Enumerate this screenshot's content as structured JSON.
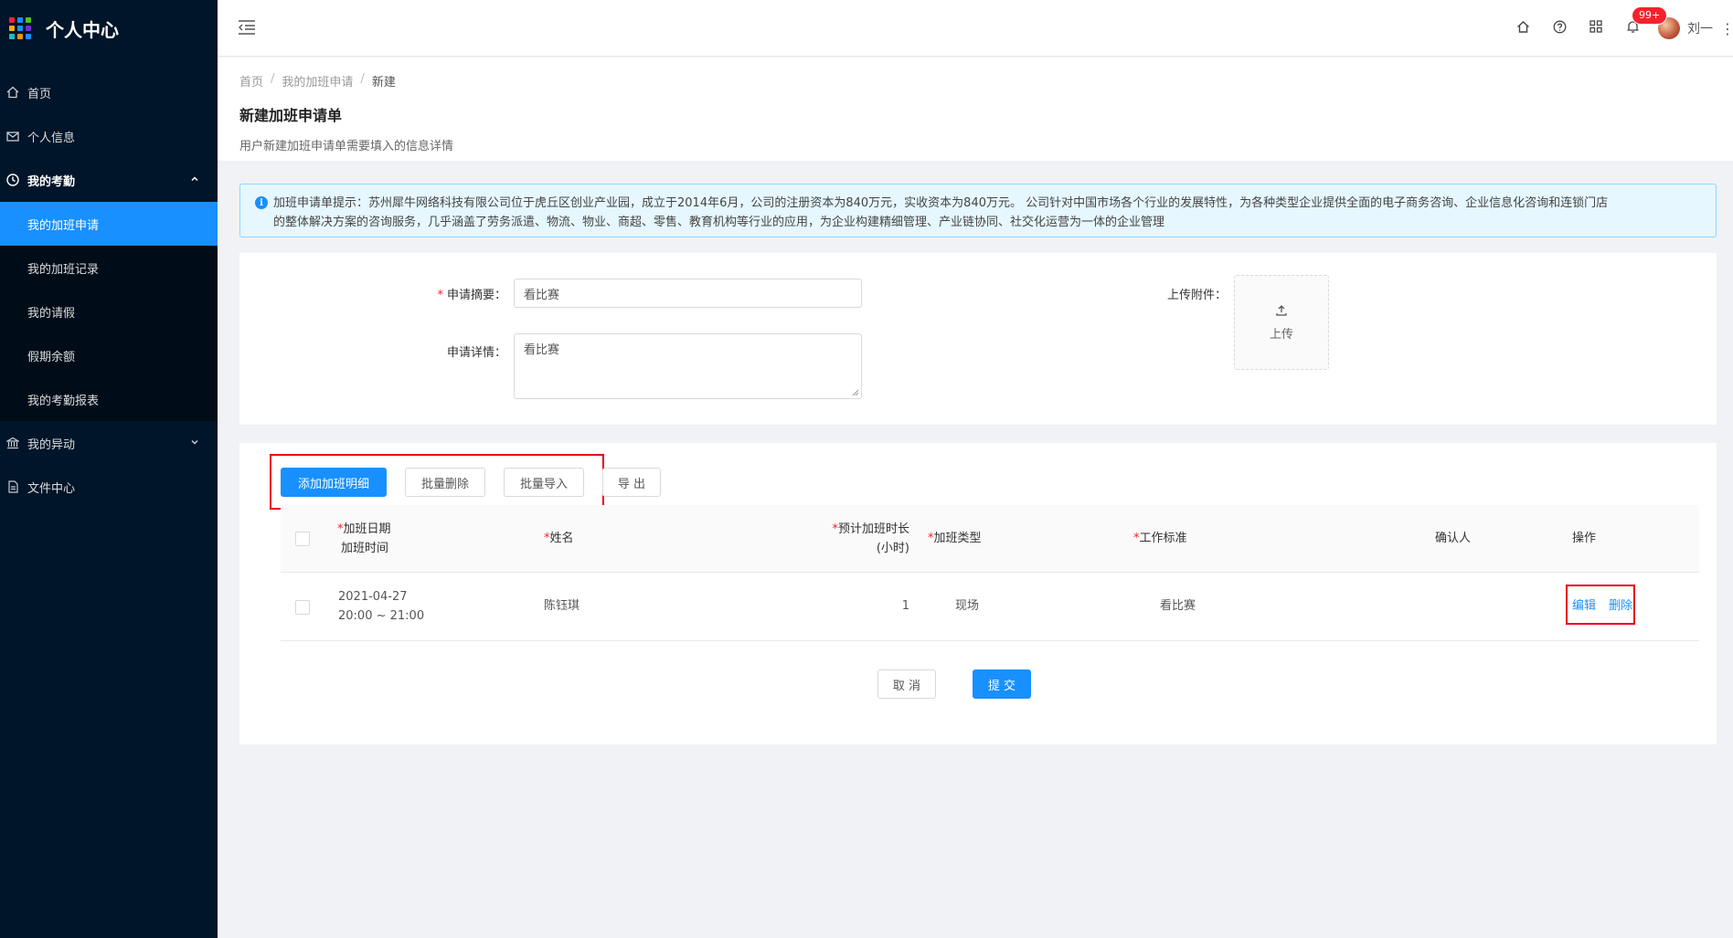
{
  "app": {
    "title": "个人中心",
    "logo_colors": [
      "#f5222d",
      "#1890ff",
      "#52c41a",
      "#faad14",
      "#1890ff",
      "#722ed1",
      "#13c2c2",
      "#fa8c16",
      "#1890ff"
    ]
  },
  "sidebar": {
    "items": [
      {
        "label": "首页",
        "icon": "home-icon"
      },
      {
        "label": "个人信息",
        "icon": "mail-icon"
      },
      {
        "label": "我的考勤",
        "icon": "clock-icon",
        "open": true
      },
      {
        "label": "我的异动",
        "icon": "bank-icon"
      },
      {
        "label": "文件中心",
        "icon": "file-icon"
      }
    ],
    "submenu": [
      {
        "label": "我的加班申请",
        "active": true
      },
      {
        "label": "我的加班记录"
      },
      {
        "label": "我的请假"
      },
      {
        "label": "假期余额"
      },
      {
        "label": "我的考勤报表"
      }
    ]
  },
  "header": {
    "notification_count": "99+",
    "username": "刘一"
  },
  "breadcrumb": [
    "首页",
    "我的加班申请",
    "新建"
  ],
  "page": {
    "title": "新建加班申请单",
    "description": "用户新建加班申请单需要填入的信息详情"
  },
  "alert": {
    "line1": "加班申请单提示：苏州犀牛网络科技有限公司位于虎丘区创业产业园，成立于2014年6月，公司的注册资本为840万元，实收资本为840万元。 公司针对中国市场各个行业的发展特性，为各种类型企业提供全面的电子商务咨询、企业信息化咨询和连锁门店",
    "line2": "的整体解决方案的咨询服务，几乎涵盖了劳务派遣、物流、物业、商超、零售、教育机构等行业的应用，为企业构建精细管理、产业链协同、社交化运营为一体的企业管理"
  },
  "form": {
    "summary_label": "申请摘要：",
    "summary_value": "看比赛",
    "detail_label": "申请详情：",
    "detail_value": "看比赛",
    "attachment_label": "上传附件：",
    "upload_label": "上传"
  },
  "toolbar": {
    "add": "添加加班明细",
    "batch_delete": "批量删除",
    "batch_import": "批量导入",
    "export": "导 出"
  },
  "table": {
    "headers": {
      "date_line1": "加班日期",
      "date_line2": "加班时间",
      "name": "姓名",
      "hours_line1": "预计加班时长",
      "hours_line2": "(小时)",
      "type": "加班类型",
      "standard": "工作标准",
      "confirmer": "确认人",
      "action": "操作"
    },
    "rows": [
      {
        "date": "2021-04-27",
        "time": "20:00 ~ 21:00",
        "name": "陈钰琪",
        "hours": "1",
        "type": "现场",
        "standard": "看比赛",
        "confirmer": "",
        "edit": "编辑",
        "delete": "删除"
      }
    ]
  },
  "footer": {
    "cancel": "取 消",
    "submit": "提 交"
  },
  "colors": {
    "sidebar_bg": "#001529",
    "primary": "#1890ff",
    "highlight": "#e8000b",
    "required": "#f5222d"
  }
}
